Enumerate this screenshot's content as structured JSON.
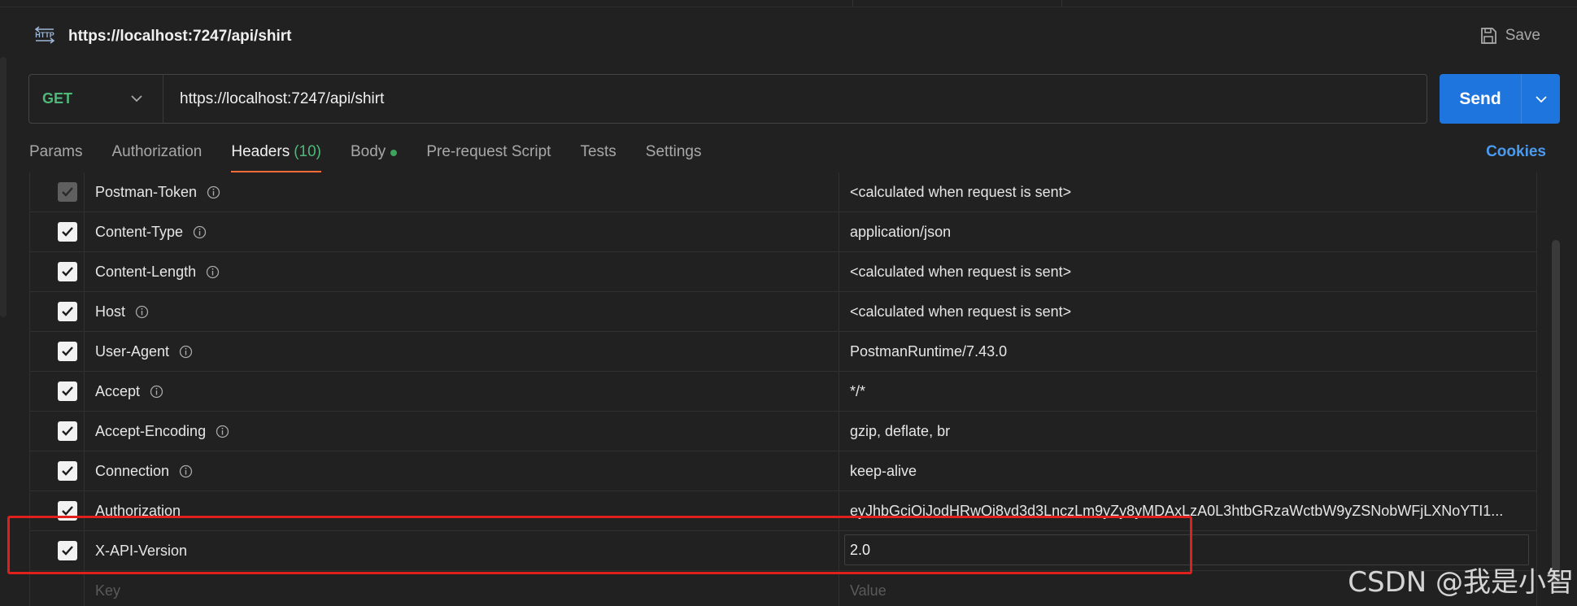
{
  "request": {
    "title": "https://localhost:7247/api/shirt",
    "save_label": "Save",
    "method": "GET",
    "url": "https://localhost:7247/api/shirt",
    "send_label": "Send"
  },
  "tabs": [
    {
      "label": "Params"
    },
    {
      "label": "Authorization"
    },
    {
      "label": "Headers",
      "count": "(10)",
      "active": true
    },
    {
      "label": "Body",
      "has_dot": true
    },
    {
      "label": "Pre-request Script"
    },
    {
      "label": "Tests"
    },
    {
      "label": "Settings"
    }
  ],
  "cookies_label": "Cookies",
  "headers": [
    {
      "key": "Postman-Token",
      "value": "<calculated when request is sent>",
      "checked": true,
      "disabled": true,
      "info": true
    },
    {
      "key": "Content-Type",
      "value": "application/json",
      "checked": true,
      "info": true
    },
    {
      "key": "Content-Length",
      "value": "<calculated when request is sent>",
      "checked": true,
      "info": true
    },
    {
      "key": "Host",
      "value": "<calculated when request is sent>",
      "checked": true,
      "info": true
    },
    {
      "key": "User-Agent",
      "value": "PostmanRuntime/7.43.0",
      "checked": true,
      "info": true
    },
    {
      "key": "Accept",
      "value": "*/*",
      "checked": true,
      "info": true
    },
    {
      "key": "Accept-Encoding",
      "value": "gzip, deflate, br",
      "checked": true,
      "info": true
    },
    {
      "key": "Connection",
      "value": "keep-alive",
      "checked": true,
      "info": true
    },
    {
      "key": "Authorization",
      "value": "eyJhbGciOiJodHRwOi8vd3d3LnczLm9yZy8yMDAxLzA0L3htbGRzaWctbW9yZSNobWFjLXNoYTI1...",
      "checked": true,
      "info": false
    },
    {
      "key": "X-API-Version",
      "value": "2.0",
      "checked": true,
      "info": false
    }
  ],
  "new_row": {
    "key_placeholder": "Key",
    "value_placeholder": "Value"
  },
  "watermark": "CSDN @我是小智",
  "colors": {
    "accent": "#ff6c37",
    "send": "#1f75de",
    "method_get": "#4eb87a",
    "highlight": "#e0201c",
    "link": "#4a9af0"
  }
}
